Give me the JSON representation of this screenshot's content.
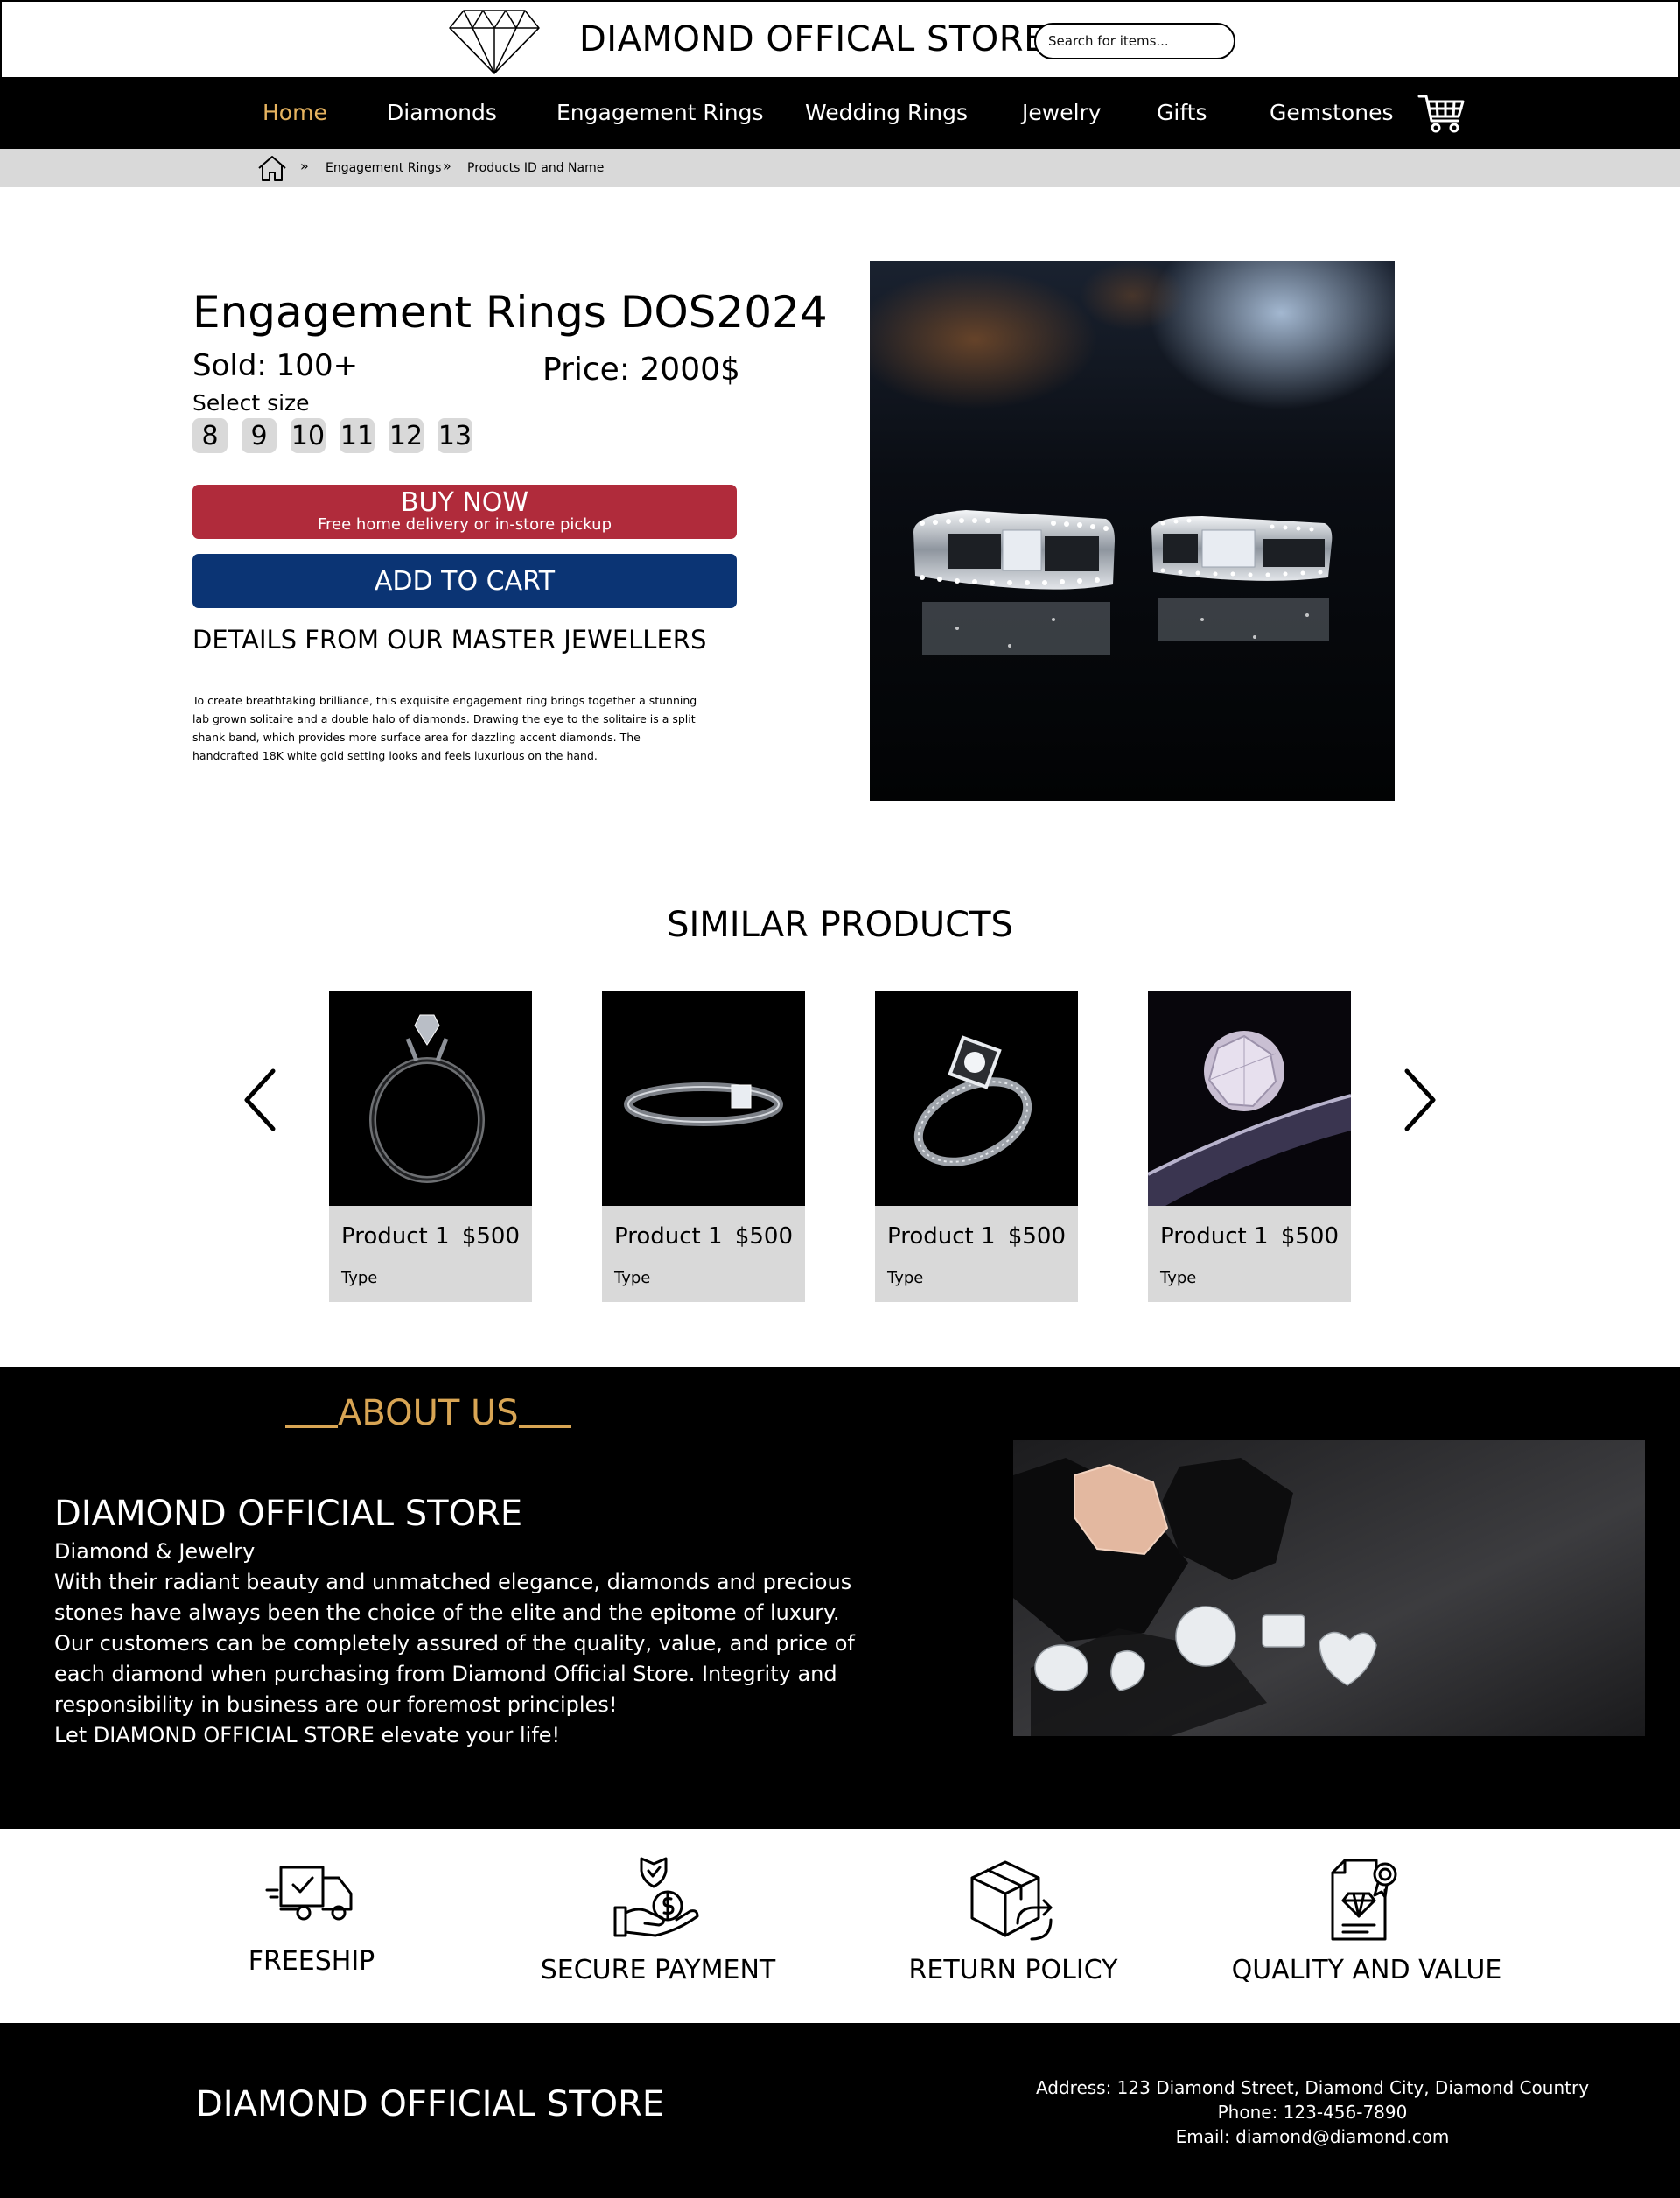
{
  "header": {
    "store_title": "DIAMOND OFFICAL STORE",
    "search_placeholder": "Search for items..."
  },
  "nav": {
    "items": [
      "Home",
      "Diamonds",
      "Engagement Rings",
      "Wedding Rings",
      "Jewelry",
      "Gifts",
      "Gemstones"
    ],
    "active_item": "Home"
  },
  "breadcrumb": {
    "items": [
      "Engagement Rings",
      "Products ID and Name"
    ]
  },
  "product": {
    "title": "Engagement Rings DOS2024",
    "sold": "Sold: 100+",
    "price": "Price: 2000$",
    "select_size_label": "Select size",
    "sizes": [
      "8",
      "9",
      "10",
      "11",
      "12",
      "13"
    ],
    "buy_now_label": "BUY NOW",
    "buy_now_sub": "Free home delivery or in-store pickup",
    "add_to_cart_label": "ADD TO CART",
    "details_title": "DETAILS FROM OUR MASTER JEWELLERS",
    "details_body": "To create breathtaking brilliance, this exquisite engagement ring brings together a stunning lab grown solitaire and a double halo of diamonds. Drawing the eye to the solitaire is a split shank band, which provides more surface area for dazzling accent diamonds. The handcrafted 18K white gold setting looks and feels luxurious on the hand."
  },
  "similar": {
    "title": "SIMILAR PRODUCTS",
    "products": [
      {
        "name": "Product 1",
        "price": "$500",
        "type": "Type"
      },
      {
        "name": "Product 1",
        "price": "$500",
        "type": "Type"
      },
      {
        "name": "Product 1",
        "price": "$500",
        "type": "Type"
      },
      {
        "name": "Product 1",
        "price": "$500",
        "type": "Type"
      }
    ]
  },
  "about": {
    "heading": "ABOUT US",
    "store_name": "DIAMOND OFFICIAL STORE",
    "subtitle": "Diamond & Jewelry",
    "paragraph1": "With their radiant beauty and unmatched elegance, diamonds and precious stones have always been the choice of the elite and the epitome of luxury.",
    "paragraph2": "Our customers can be completely assured of the quality, value, and price of each diamond when purchasing from Diamond Official Store. Integrity and responsibility in business are our foremost principles!",
    "paragraph3": "Let DIAMOND OFFICIAL STORE elevate your life!"
  },
  "features": [
    {
      "label": "FREESHIP",
      "icon": "delivery-truck-icon"
    },
    {
      "label": "SECURE PAYMENT",
      "icon": "secure-payment-icon"
    },
    {
      "label": "RETURN POLICY",
      "icon": "return-box-icon"
    },
    {
      "label": "QUALITY AND VALUE",
      "icon": "certificate-icon"
    }
  ],
  "footer": {
    "store_name": "DIAMOND OFFICIAL STORE",
    "address": "Address: 123 Diamond Street, Diamond City, Diamond Country",
    "phone": "Phone: 123-456-7890",
    "email": "Email: diamond@diamond.com"
  },
  "colors": {
    "nav_active": "#e6b35f",
    "buy_now": "#b02b3b",
    "add_to_cart": "#0b3474",
    "about_heading": "#d8a554",
    "breadcrumb_bar": "#d9d9d9"
  }
}
